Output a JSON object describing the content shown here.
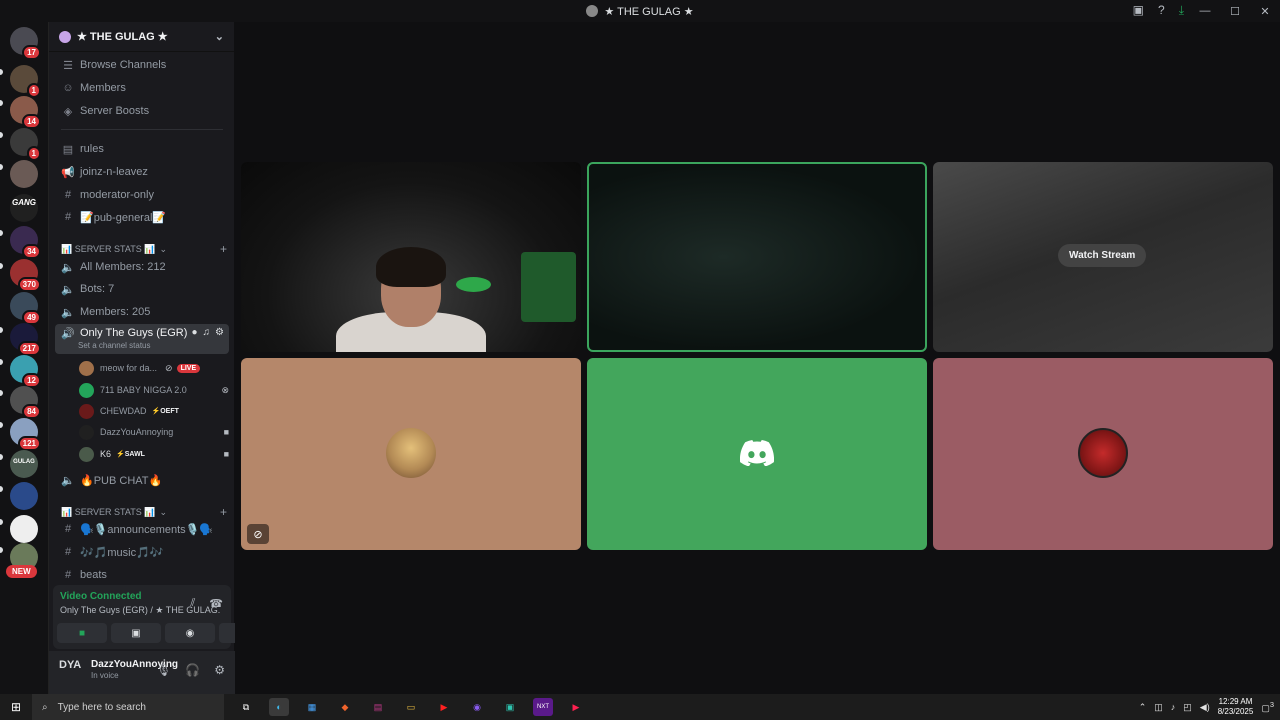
{
  "window": {
    "title": "★ THE GULAG ★",
    "controls": [
      "—",
      "☐",
      "✕"
    ]
  },
  "server_rail": {
    "servers": [
      {
        "badge": "17",
        "color": "#4a4a52"
      },
      {
        "badge": "1",
        "color": "#5a4a3a"
      },
      {
        "badge": "14",
        "color": "#8a5a4a"
      },
      {
        "badge": "1",
        "color": "#3a3a3a"
      },
      {
        "badge": "",
        "color": "#6a5a55"
      },
      {
        "badge": "",
        "color": "#202020"
      },
      {
        "badge": "34",
        "color": "#3a2a50"
      },
      {
        "badge": "370",
        "color": "#9a3030"
      },
      {
        "badge": "49",
        "color": "#3a4a5a"
      },
      {
        "badge": "217",
        "color": "#1a1a3a"
      },
      {
        "badge": "12",
        "color": "#3aa0b0"
      },
      {
        "badge": "84",
        "color": "#505050"
      },
      {
        "badge": "121",
        "color": "#8aa0c0"
      },
      {
        "badge": "",
        "color": "#4a5a50"
      },
      {
        "badge": "",
        "color": "#2a4a8a"
      },
      {
        "badge": "",
        "color": "#eeeeee"
      },
      {
        "badge": "",
        "color": "#6a7a5a"
      }
    ],
    "new_label": "NEW",
    "gang_label": "GANG",
    "gulag_label": "GULAG"
  },
  "channel_panel": {
    "server_name": "★ THE GULAG ★",
    "top_items": [
      {
        "icon": "browse-icon",
        "label": "Browse Channels"
      },
      {
        "icon": "members-icon",
        "label": "Members"
      },
      {
        "icon": "boost-icon",
        "label": "Server Boosts"
      }
    ],
    "channels_1": [
      {
        "icon": "rules-icon",
        "label": "rules"
      },
      {
        "icon": "announce-icon",
        "label": "joinz-n-leavez"
      },
      {
        "icon": "hash-icon",
        "label": "moderator-only"
      },
      {
        "icon": "hash-icon",
        "label": "📝pub-general📝"
      }
    ],
    "cat1": "📊 SERVER STATS 📊",
    "stats": [
      {
        "label": "All Members: 212"
      },
      {
        "label": "Bots: 7"
      },
      {
        "label": "Members: 205"
      }
    ],
    "active_channel": {
      "label": "Only The Guys (EGR)",
      "sub": "Set a channel status"
    },
    "voice_users": [
      {
        "name": "meow for da...",
        "tag": "",
        "color": "#a0704a"
      },
      {
        "name": "711 BABY NIGGA 2.0",
        "tag": "",
        "color": "#23a55a"
      },
      {
        "name": "CHEWDAD",
        "tag": "⚡OEFT",
        "color": "#6a1a1a"
      },
      {
        "name": "DazzYouAnnoying",
        "tag": "",
        "color": "#202020"
      },
      {
        "name": "K6",
        "tag": "⚡SAWL",
        "color": "#4a5a4a"
      }
    ],
    "live_label": "LIVE",
    "pub_chat": "🔥PUB CHAT🔥",
    "cat2": "📊 SERVER STATS 📊",
    "channels_2": [
      {
        "label": "🗣️🎙️announcements🎙️🗣️"
      },
      {
        "label": "🎶🎵music🎵🎶"
      },
      {
        "label": "beats"
      }
    ]
  },
  "voice_panel": {
    "status": "Video Connected",
    "location": "Only The Guys (EGR) / ★ THE GULAG...",
    "buttons": [
      "camera",
      "screen-share",
      "activity",
      "soundboard"
    ]
  },
  "user_panel": {
    "avatar_text": "DYA",
    "username": "DazzYouAnnoying",
    "status": "In voice"
  },
  "stage": {
    "watch_stream": "Watch Stream"
  },
  "taskbar": {
    "search_placeholder": "Type here to search",
    "time": "12:29 AM",
    "date": "8/23/2025",
    "notif_count": "3",
    "apps": [
      "task-view",
      "edge",
      "store",
      "brave",
      "winrar",
      "files",
      "youtube",
      "discord",
      "app",
      "next",
      "youtube2"
    ]
  }
}
